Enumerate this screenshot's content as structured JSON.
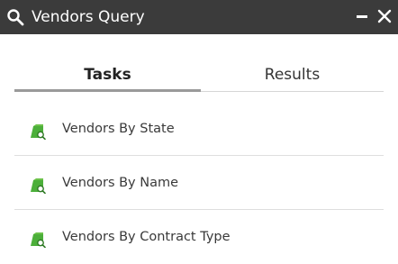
{
  "window": {
    "title": "Vendors Query",
    "title_icon": "search-icon",
    "minimize_icon": "minimize-icon",
    "close_icon": "close-icon"
  },
  "tabs": [
    {
      "label": "Tasks",
      "active": true
    },
    {
      "label": "Results",
      "active": false
    }
  ],
  "tasks": [
    {
      "label": "Vendors By State",
      "icon": "query-layer-icon"
    },
    {
      "label": "Vendors By Name",
      "icon": "query-layer-icon"
    },
    {
      "label": "Vendors By Contract Type",
      "icon": "query-layer-icon"
    }
  ],
  "colors": {
    "titlebar_bg": "#3b3b3b",
    "icon_green": "#4caf3a",
    "icon_dark_green": "#2f7a25"
  }
}
